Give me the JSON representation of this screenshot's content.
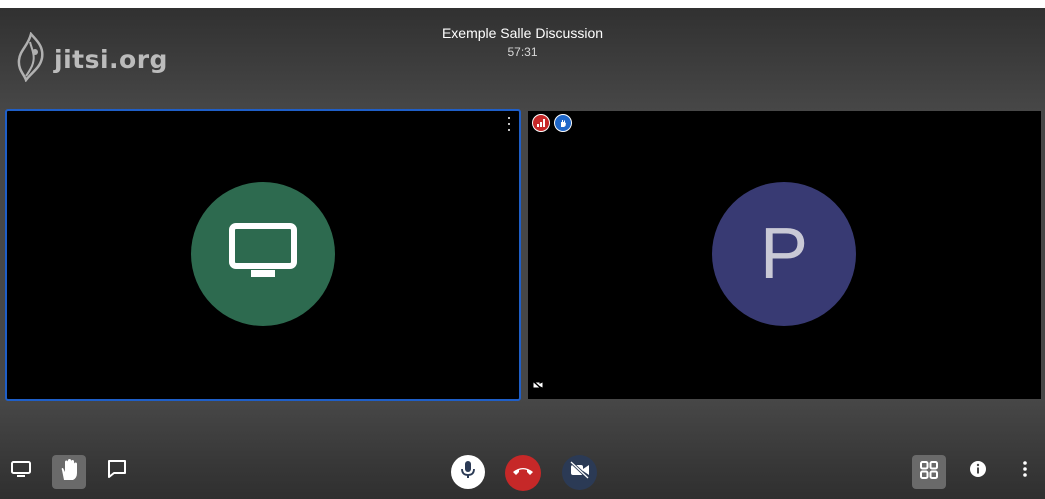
{
  "branding": {
    "logo_text": "jitsi.org",
    "logo_icon": "jitsi-leaf-icon"
  },
  "meeting": {
    "title": "Exemple Salle Discussion",
    "timer": "57:31"
  },
  "tiles": [
    {
      "id": "screen-share-participant",
      "avatar_icon": "monitor-icon",
      "avatar_color": "#2d6a4f",
      "active_speaker": true,
      "menu_icon": "kebab-menu-icon"
    },
    {
      "id": "participant-p",
      "avatar_initial": "P",
      "avatar_color": "#383a73",
      "indicators": [
        "connection-quality-icon",
        "raised-hand-icon"
      ],
      "status_icon": "video-off-icon"
    }
  ],
  "toolbar": {
    "left": [
      "screen-share-icon",
      "raise-hand-icon",
      "chat-icon"
    ],
    "center": [
      "microphone-icon",
      "hangup-icon",
      "camera-off-icon"
    ],
    "right": [
      "tile-view-icon",
      "info-icon",
      "more-options-icon"
    ]
  },
  "colors": {
    "accent_blue": "#1f5fc8",
    "hangup_red": "#c62828",
    "background": "#474747"
  }
}
